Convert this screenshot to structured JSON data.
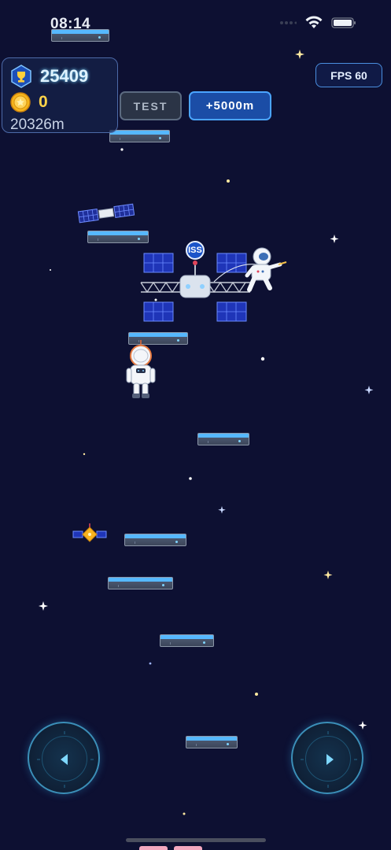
{
  "status_bar": {
    "time": "08:14"
  },
  "hud": {
    "score": "25409",
    "coins": "0",
    "distance": "20326m",
    "test_button": "TEST",
    "boost_button": "+5000m",
    "fps_label": "FPS 60"
  },
  "scene": {
    "station_label": "ISS",
    "objects": [
      "satellite",
      "space-station",
      "astronaut-floating",
      "astronaut-player",
      "small-satellite"
    ]
  },
  "controls": {
    "left": "left-arrow-icon",
    "right": "right-arrow-icon"
  },
  "colors": {
    "background": "#0d1032",
    "platform_top": "#56b8ff",
    "accent_blue": "#1b4da6",
    "coin_gold": "#ffd44a"
  }
}
